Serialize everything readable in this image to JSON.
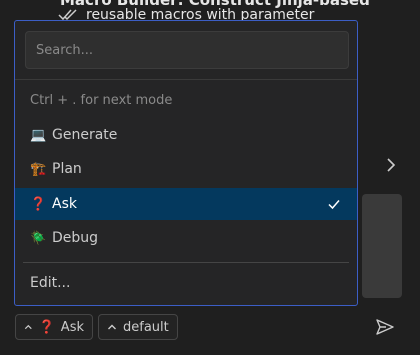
{
  "background": {
    "heading": "Macro Builder: Construct Jinja-based",
    "subtext": "reusable macros with parameter"
  },
  "dropdown": {
    "search_placeholder": "Search...",
    "hint": "Ctrl + . for next mode",
    "items": [
      {
        "icon": "💻",
        "label": "Generate",
        "selected": false
      },
      {
        "icon": "🏗️",
        "label": "Plan",
        "selected": false
      },
      {
        "icon": "❓",
        "label": "Ask",
        "selected": true
      },
      {
        "icon": "🪲",
        "label": "Debug",
        "selected": false
      }
    ],
    "edit_label": "Edit..."
  },
  "footer": {
    "mode_icon": "❓",
    "mode_label": "Ask",
    "model_label": "default"
  },
  "colors": {
    "accent_border": "#3c5ec6",
    "selected_bg": "#04395e"
  }
}
